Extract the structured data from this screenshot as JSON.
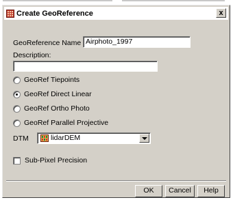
{
  "window": {
    "title": "Create GeoReference",
    "close_label": "x"
  },
  "form": {
    "georef_name_label": "GeoReference Name",
    "georef_name_value": "Airphoto_1997",
    "description_label": "Description:",
    "description_value": ""
  },
  "options": [
    {
      "label": "GeoRef Tiepoints",
      "checked": false
    },
    {
      "label": "GeoRef Direct Linear",
      "checked": true
    },
    {
      "label": "GeoRef Ortho Photo",
      "checked": false
    },
    {
      "label": "GeoRef Parallel Projective",
      "checked": false
    }
  ],
  "dtm": {
    "label": "DTM",
    "selected": "lidarDEM",
    "icon": "raster-grid-icon"
  },
  "subpixel": {
    "label": "Sub-Pixel Precision",
    "checked": false
  },
  "buttons": {
    "ok": "OK",
    "cancel": "Cancel",
    "help": "Help"
  }
}
